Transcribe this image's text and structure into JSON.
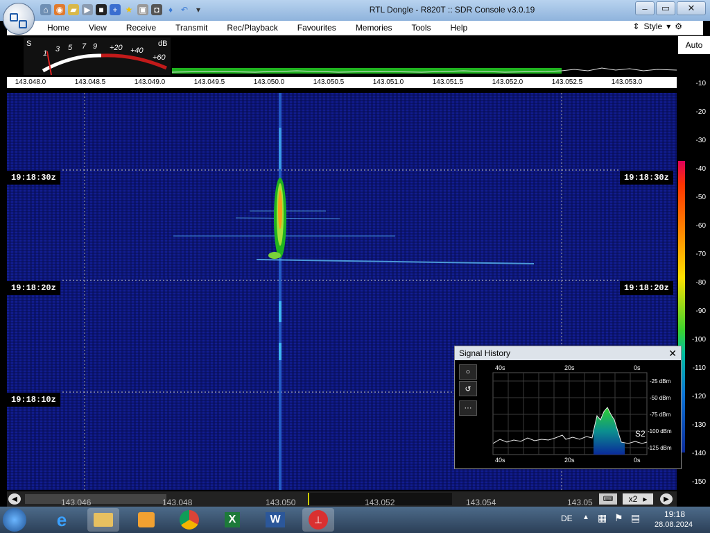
{
  "window": {
    "title": "RTL Dongle - R820T :: SDR Console v3.0.19"
  },
  "menu": {
    "items": [
      "Home",
      "View",
      "Receive",
      "Transmit",
      "Rec/Playback",
      "Favourites",
      "Memories",
      "Tools",
      "Help"
    ],
    "style_label": "Style"
  },
  "meter": {
    "s_label": "S",
    "db_label": "dB",
    "s_scale": [
      "1",
      "3",
      "5",
      "7",
      "9"
    ],
    "db_scale": [
      "+20",
      "+40",
      "+60"
    ]
  },
  "frequency_scale": [
    "143.048.0",
    "143.048.5",
    "143.049.0",
    "143.049.5",
    "143.050.0",
    "143.050.5",
    "143.051.0",
    "143.051.5",
    "143.052.0",
    "143.052.5",
    "143.053.0"
  ],
  "waterfall": {
    "timestamps": [
      "19:18:30z",
      "19:18:20z",
      "19:18:10z"
    ]
  },
  "db_axis": {
    "auto_label": "Auto",
    "labels": [
      "-10",
      "-20",
      "-30",
      "-40",
      "-50",
      "-60",
      "-70",
      "-80",
      "-90",
      "-100",
      "-110",
      "-120",
      "-130",
      "-140",
      "-150"
    ]
  },
  "bottom_scroller": {
    "labels": [
      "143.046",
      "143.048",
      "143.050",
      "143.052",
      "143.054",
      "143.05"
    ],
    "zoom": "x2"
  },
  "signal_history": {
    "title": "Signal History",
    "time_top": [
      "40s",
      "20s",
      "0s"
    ],
    "time_bottom": [
      "40s",
      "20s",
      "0s"
    ],
    "dbm_labels": [
      "-25 dBm",
      "-50 dBm",
      "-75 dBm",
      "-100 dBm",
      "-125 dBm"
    ],
    "s_reading": "S2"
  },
  "taskbar": {
    "lang": "DE",
    "time": "19:18",
    "date": "28.08.2024"
  },
  "colors": {
    "waterfall_bg": "#0e1778",
    "signal": "#3cd22e",
    "accent_green": "#1fb31f"
  }
}
